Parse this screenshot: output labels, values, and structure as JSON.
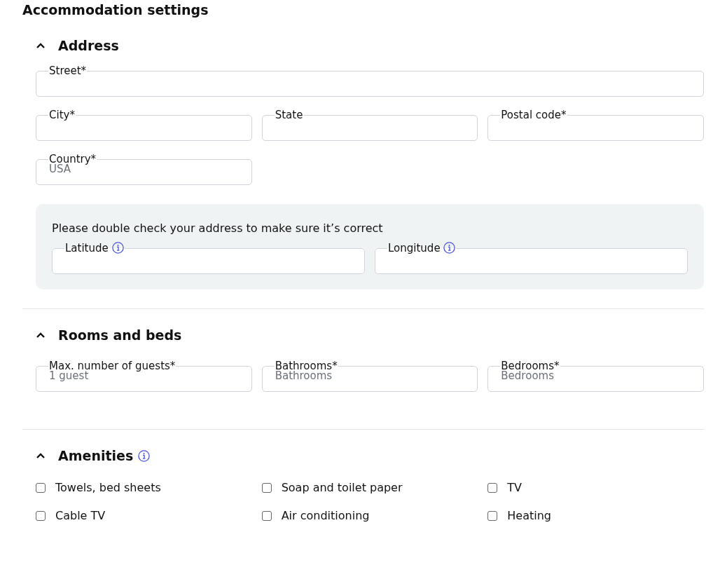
{
  "page_title": "Accommodation settings",
  "sections": [
    {
      "kind": "form",
      "title": "Address",
      "expanded": true,
      "rows": [
        [
          {
            "label": "Street*",
            "wide": true
          }
        ],
        [
          {
            "label": "City*"
          },
          {
            "label": "State"
          },
          {
            "label": "Postal code*"
          }
        ],
        [
          {
            "label": "Country*",
            "value": "USA"
          }
        ]
      ],
      "notice": {
        "text": "Please double check your address to make sure it’s correct",
        "fields": [
          {
            "label": "Latitude",
            "info": true
          },
          {
            "label": "Longitude",
            "info": true
          }
        ]
      }
    },
    {
      "kind": "form",
      "title": "Rooms and beds",
      "expanded": true,
      "rows": [
        [
          {
            "label": "Max. number of guests*",
            "placeholder": "1 guest"
          },
          {
            "label": "Bathrooms*",
            "placeholder": "Bathrooms"
          },
          {
            "label": "Bedrooms*",
            "placeholder": "Bedrooms"
          }
        ]
      ]
    },
    {
      "kind": "checklist",
      "title": "Amenities",
      "expanded": true,
      "info": true,
      "items": [
        {
          "label": "Towels, bed sheets",
          "checked": false
        },
        {
          "label": "Soap and toilet paper",
          "checked": false
        },
        {
          "label": "TV",
          "checked": false
        },
        {
          "label": "Cable TV",
          "checked": false
        },
        {
          "label": "Air conditioning",
          "checked": false
        },
        {
          "label": "Heating",
          "checked": false
        }
      ]
    }
  ]
}
